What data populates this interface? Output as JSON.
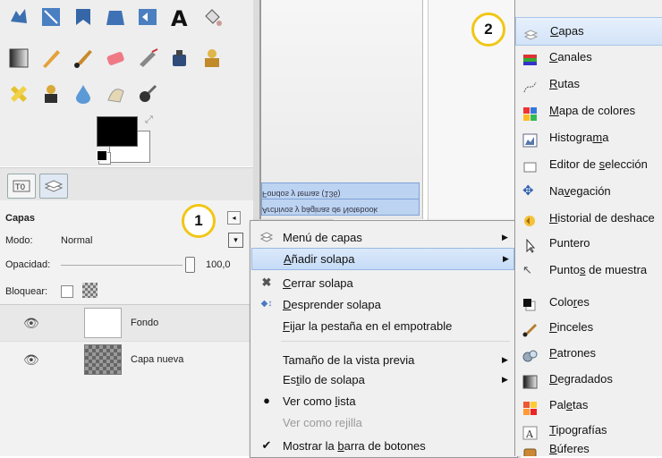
{
  "layers_panel": {
    "title": "Capas",
    "mode_label": "Modo:",
    "mode_value": "Normal",
    "opacity_label": "Opacidad:",
    "opacity_value": "100,0",
    "lock_label": "Bloquear:",
    "layers": [
      {
        "name": "Fondo"
      },
      {
        "name": "Capa nueva"
      }
    ]
  },
  "canvas_overlay": {
    "line1": "Fondos y temas (136)",
    "line2": "Archivos y páginas de Notebook"
  },
  "badges": {
    "one": "1",
    "two": "2"
  },
  "context_menu": {
    "items": [
      {
        "label": "Menú de capas",
        "has_submenu": true,
        "icon": "layers-menu-icon"
      },
      {
        "label": "Añadir solapa",
        "has_submenu": true,
        "highlighted": true
      },
      {
        "label": "Cerrar solapa",
        "icon": "close-icon"
      },
      {
        "label": "Desprender solapa",
        "icon": "detach-icon"
      },
      {
        "label": "Fijar la pestaña en el empotrable"
      },
      {
        "label": "Tamaño de la vista previa",
        "has_submenu": true
      },
      {
        "label": "Estilo de solapa",
        "has_submenu": true
      },
      {
        "label": "Ver como lista",
        "icon": "bullet-icon"
      },
      {
        "label": "Ver como rejilla",
        "disabled": true
      },
      {
        "label": "Mostrar la barra de botones",
        "icon": "checkmark-icon"
      }
    ]
  },
  "submenu": {
    "items": [
      {
        "label": "Capas",
        "icon": "layers-icon",
        "highlighted": true
      },
      {
        "label": "Canales",
        "icon": "channels-icon"
      },
      {
        "label": "Rutas",
        "icon": "paths-icon"
      },
      {
        "label": "Mapa de colores",
        "icon": "colormap-icon"
      },
      {
        "label": "Histograma",
        "icon": "histogram-icon"
      },
      {
        "label": "Editor de selección",
        "icon": "selection-editor-icon"
      },
      {
        "label": "Navegación",
        "icon": "navigation-icon"
      },
      {
        "label": "Historial de deshace",
        "icon": "undo-history-icon"
      },
      {
        "label": "Puntero",
        "icon": "pointer-icon"
      },
      {
        "label": "Puntos de muestra",
        "icon": "sample-points-icon"
      },
      {
        "label": "Colores",
        "icon": "colors-icon"
      },
      {
        "label": "Pinceles",
        "icon": "brushes-icon"
      },
      {
        "label": "Patrones",
        "icon": "patterns-icon"
      },
      {
        "label": "Degradados",
        "icon": "gradients-icon"
      },
      {
        "label": "Paletas",
        "icon": "palettes-icon"
      },
      {
        "label": "Tipografías",
        "icon": "fonts-icon"
      },
      {
        "label": "Búferes",
        "icon": "buffers-icon"
      }
    ]
  },
  "colors": {
    "highlight": "#c5dbf6",
    "badge_ring": "#f2c615"
  }
}
